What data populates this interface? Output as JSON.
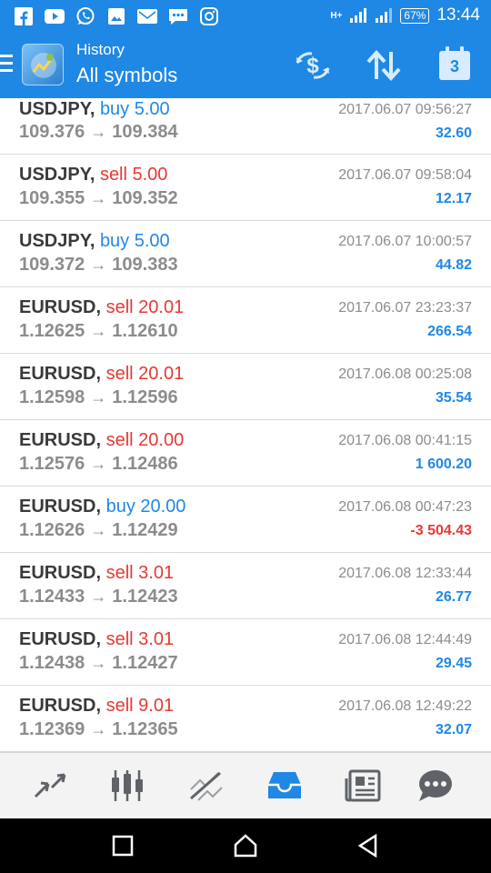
{
  "status_bar": {
    "icons": [
      "facebook-icon",
      "youtube-icon",
      "whatsapp-icon",
      "image-icon",
      "gmail-icon",
      "chat-icon",
      "instagram-icon"
    ],
    "network": "H+",
    "battery": "67%",
    "time": "13:44"
  },
  "app_bar": {
    "title": "History",
    "subtitle": "All symbols",
    "calendar_badge": "3",
    "icons": [
      "menu-icon",
      "app-logo",
      "currency-exchange-icon",
      "sort-icon",
      "calendar-icon"
    ]
  },
  "trades": [
    {
      "symbol": "USDJPY,",
      "side": "buy",
      "lots": "buy 5.00",
      "open": "109.376",
      "close": "109.384",
      "time": "2017.06.07 09:56:27",
      "profit": "32.60"
    },
    {
      "symbol": "USDJPY,",
      "side": "sell",
      "lots": "sell 5.00",
      "open": "109.355",
      "close": "109.352",
      "time": "2017.06.07 09:58:04",
      "profit": "12.17"
    },
    {
      "symbol": "USDJPY,",
      "side": "buy",
      "lots": "buy 5.00",
      "open": "109.372",
      "close": "109.383",
      "time": "2017.06.07 10:00:57",
      "profit": "44.82"
    },
    {
      "symbol": "EURUSD,",
      "side": "sell",
      "lots": "sell 20.01",
      "open": "1.12625",
      "close": "1.12610",
      "time": "2017.06.07 23:23:37",
      "profit": "266.54"
    },
    {
      "symbol": "EURUSD,",
      "side": "sell",
      "lots": "sell 20.01",
      "open": "1.12598",
      "close": "1.12596",
      "time": "2017.06.08 00:25:08",
      "profit": "35.54"
    },
    {
      "symbol": "EURUSD,",
      "side": "sell",
      "lots": "sell 20.00",
      "open": "1.12576",
      "close": "1.12486",
      "time": "2017.06.08 00:41:15",
      "profit": "1 600.20"
    },
    {
      "symbol": "EURUSD,",
      "side": "buy",
      "lots": "buy 20.00",
      "open": "1.12626",
      "close": "1.12429",
      "time": "2017.06.08 00:47:23",
      "profit": "-3 504.43"
    },
    {
      "symbol": "EURUSD,",
      "side": "sell",
      "lots": "sell 3.01",
      "open": "1.12433",
      "close": "1.12423",
      "time": "2017.06.08 12:33:44",
      "profit": "26.77"
    },
    {
      "symbol": "EURUSD,",
      "side": "sell",
      "lots": "sell 3.01",
      "open": "1.12438",
      "close": "1.12427",
      "time": "2017.06.08 12:44:49",
      "profit": "29.45"
    },
    {
      "symbol": "EURUSD,",
      "side": "sell",
      "lots": "sell 9.01",
      "open": "1.12369",
      "close": "1.12365",
      "time": "2017.06.08 12:49:22",
      "profit": "32.07"
    }
  ],
  "arrow": "→",
  "bottom_nav": {
    "items": [
      "quotes-icon",
      "chart-icon",
      "trade-icon",
      "history-icon",
      "news-icon",
      "chat-icon"
    ],
    "active": "history-icon",
    "active_color": "#1f88e5",
    "inactive_color": "#5f6368"
  },
  "colors": {
    "accent": "#1f88e5",
    "buy": "#1f88e5",
    "sell": "#e53935",
    "muted": "#8c8c8c"
  }
}
